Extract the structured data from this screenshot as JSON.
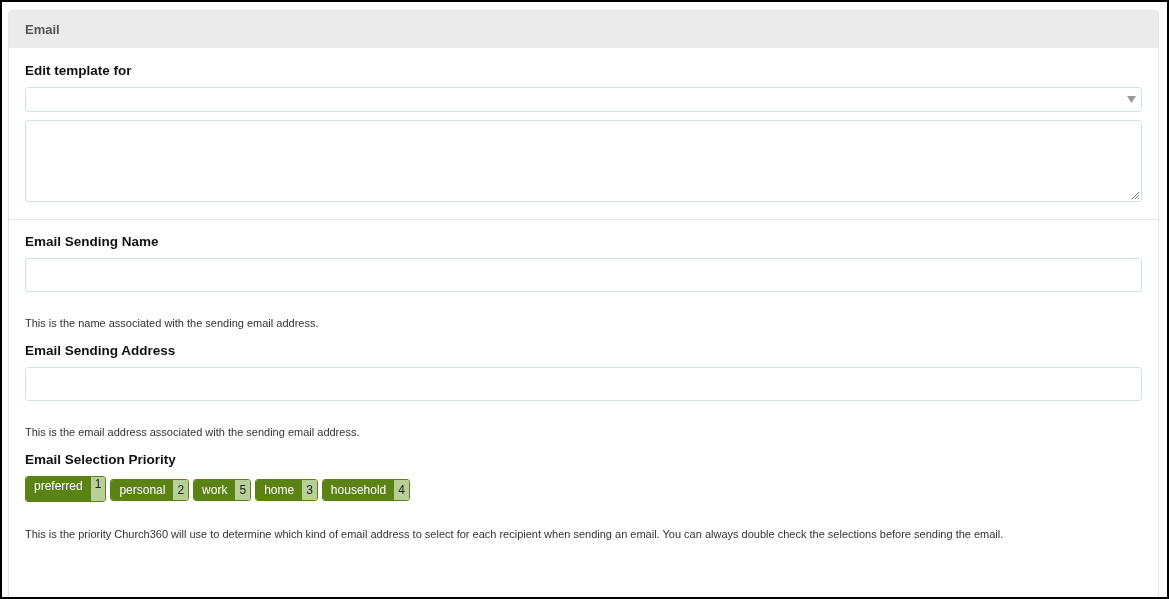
{
  "panel": {
    "title": "Email"
  },
  "template": {
    "label": "Edit template for"
  },
  "sending_name": {
    "label": "Email Sending Name",
    "help": "This is the name associated with the sending email address."
  },
  "sending_address": {
    "label": "Email Sending Address",
    "help": "This is the email address associated with the sending email address."
  },
  "priority": {
    "label": "Email Selection Priority",
    "tags": [
      {
        "label": "preferred",
        "rank": "1",
        "selected": true
      },
      {
        "label": "personal",
        "rank": "2",
        "selected": false
      },
      {
        "label": "work",
        "rank": "5",
        "selected": false
      },
      {
        "label": "home",
        "rank": "3",
        "selected": false
      },
      {
        "label": "household",
        "rank": "4",
        "selected": false
      }
    ],
    "help": "This is the priority Church360 will use to determine which kind of email address to select for each recipient when sending an email. You can always double check the selections before sending the email."
  }
}
